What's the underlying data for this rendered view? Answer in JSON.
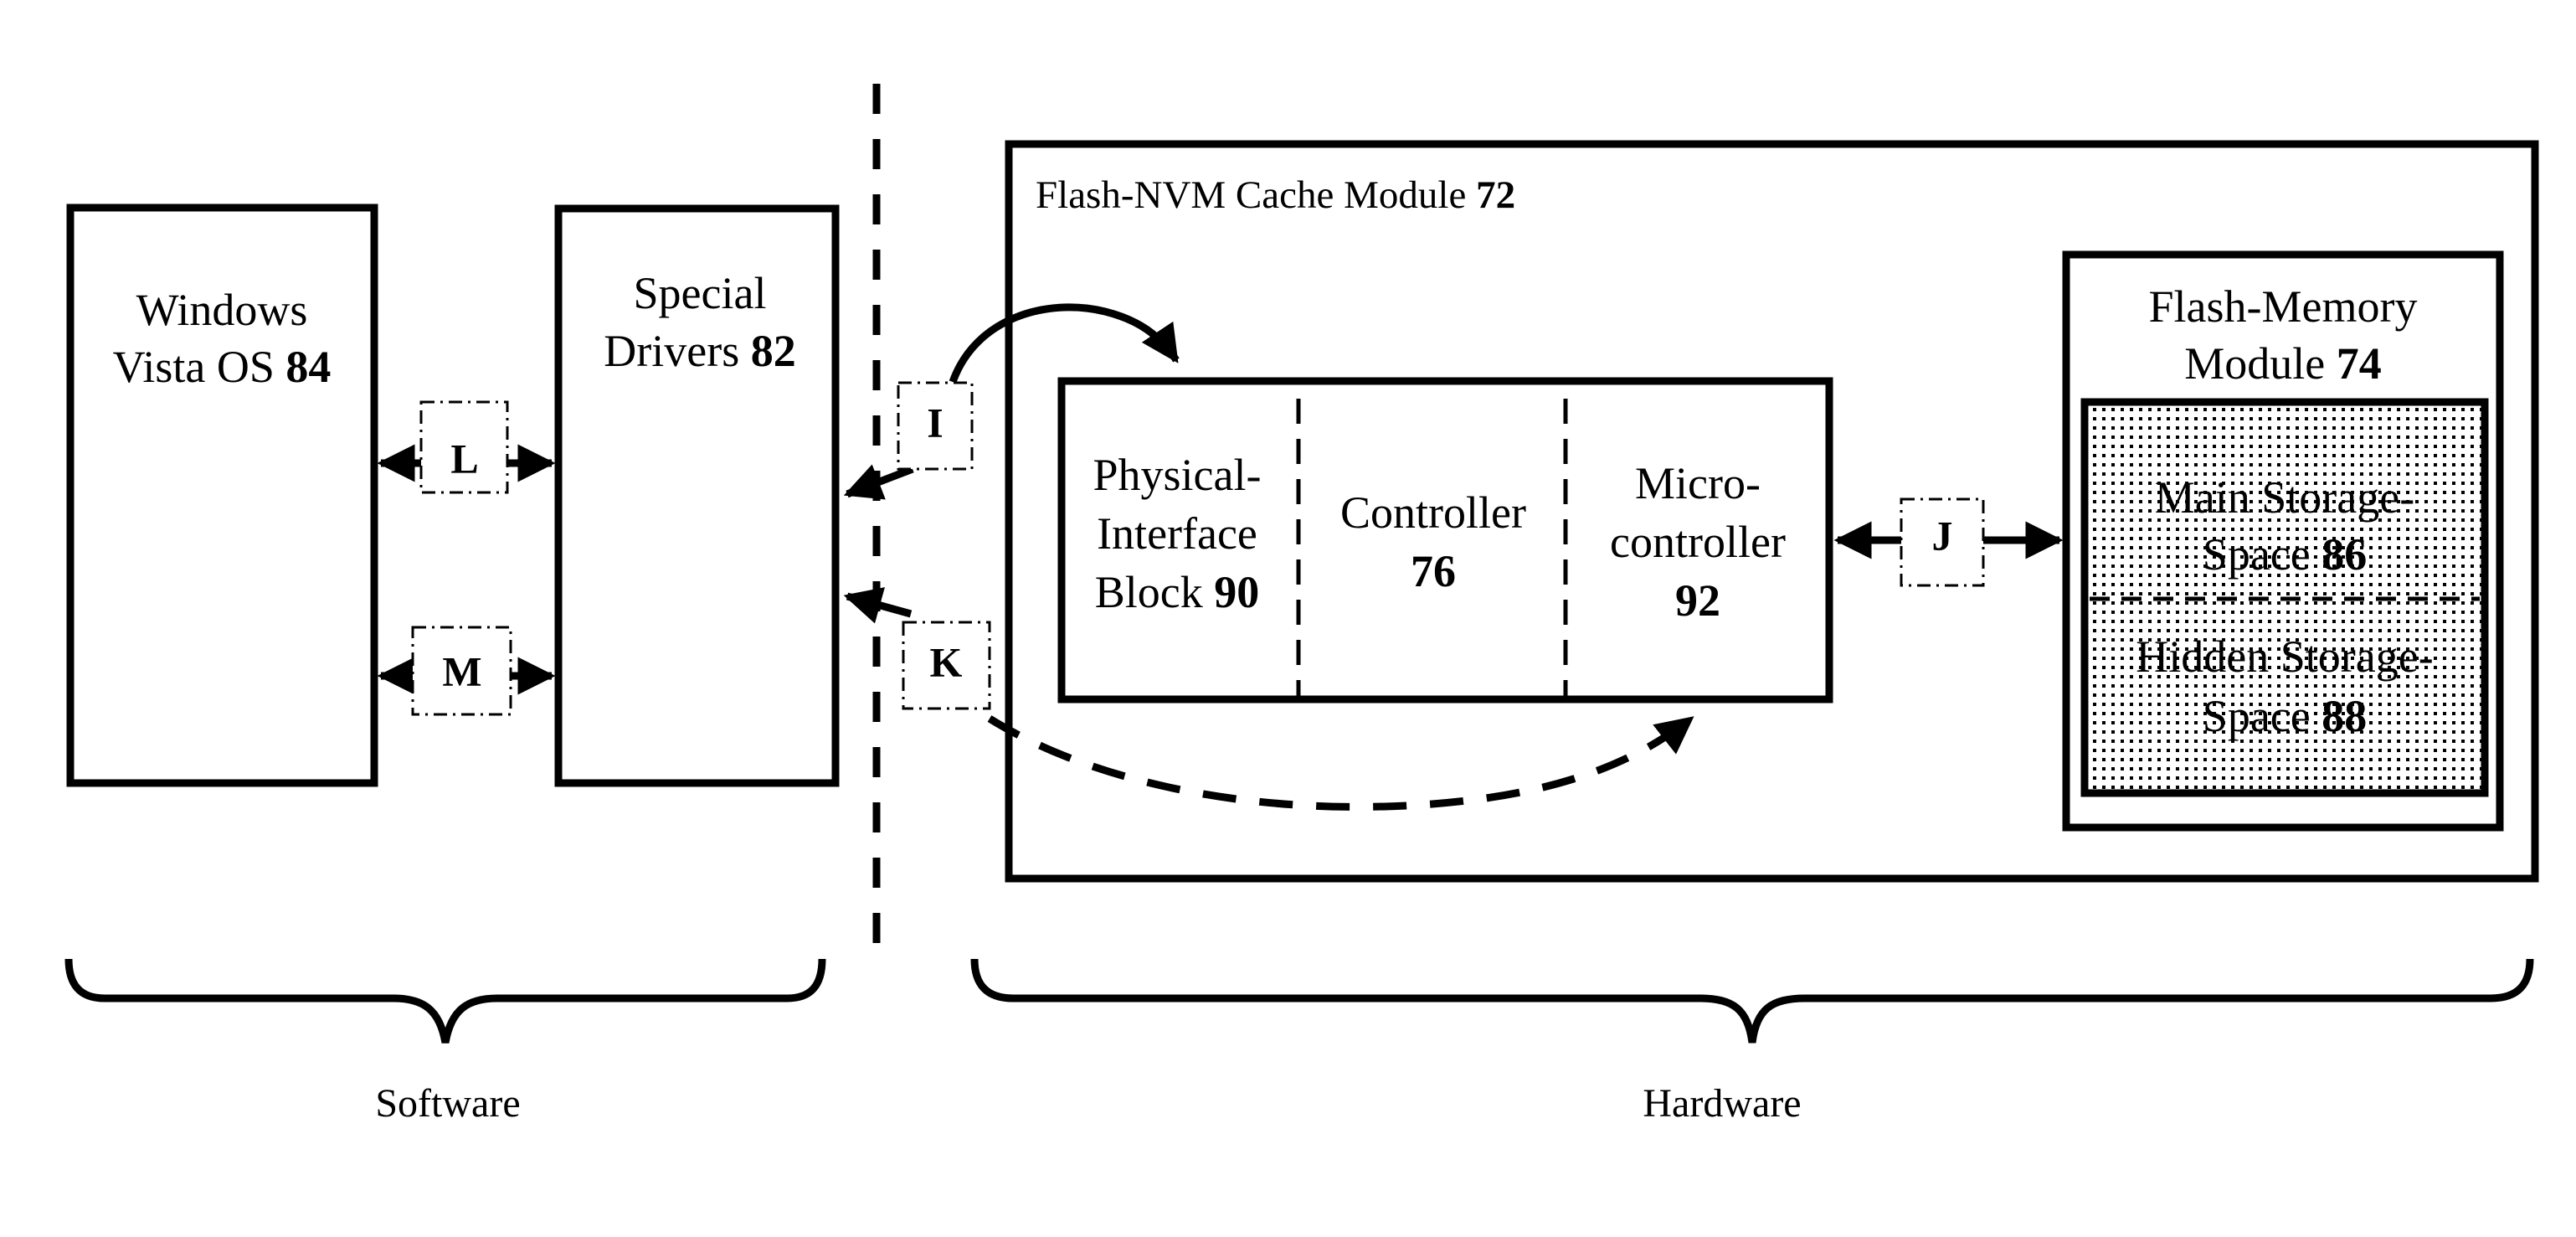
{
  "diagram": {
    "regions": {
      "software": "Software",
      "hardware": "Hardware"
    },
    "software_blocks": {
      "os": {
        "line1": "Windows",
        "line2_text": "Vista OS ",
        "line2_num": "84"
      },
      "drivers": {
        "line1": "Special",
        "line2_text": "Drivers ",
        "line2_num": "82"
      }
    },
    "cache_module": {
      "title_text": "Flash-NVM Cache Module ",
      "title_num": "72",
      "interface_block": {
        "line1": "Physical-",
        "line2": "Interface",
        "line3_text": "Block ",
        "line3_num": "90"
      },
      "controller": {
        "line1": "Controller",
        "line2_num": "76"
      },
      "microcontroller": {
        "line1": "Micro-",
        "line2": "controller",
        "line3_num": "92"
      },
      "flash_memory": {
        "line1": "Flash-Memory",
        "line2_text": "Module ",
        "line2_num": "74",
        "main_storage": {
          "line1": "Main Storage-",
          "line2_text": "Space ",
          "line2_num": "86"
        },
        "hidden_storage": {
          "line1": "Hidden Storage-",
          "line2_text": "Space ",
          "line2_num": "88"
        }
      }
    },
    "paths": {
      "I": "I",
      "J": "J",
      "K": "K",
      "L": "L",
      "M": "M"
    },
    "colors": {
      "ink": "#000000",
      "background": "#ffffff",
      "storage_fill": "#d9d9d9"
    }
  }
}
